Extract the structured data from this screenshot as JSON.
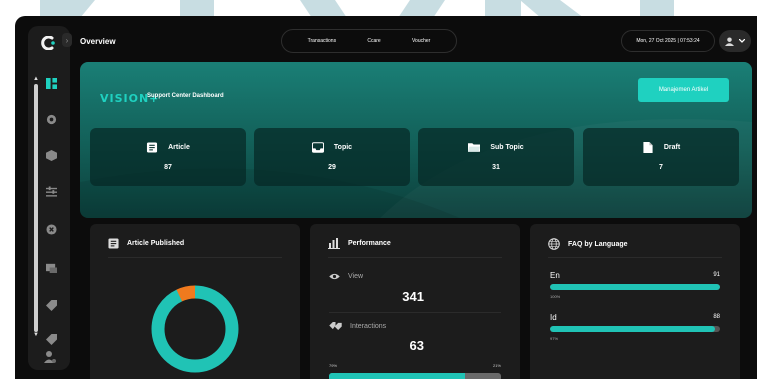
{
  "header": {
    "page_title": "Overview",
    "tabs": [
      "Transactions",
      "Ccare",
      "Voucher"
    ],
    "datetime": "Mon, 27 Oct 2025 | 07:53:24"
  },
  "hero": {
    "logo_text": "VISION+",
    "title": "Support Center Dashboard",
    "manage_button": "Manajemen Artikel",
    "stats": [
      {
        "label": "Article",
        "value": "87",
        "icon": "document-icon"
      },
      {
        "label": "Topic",
        "value": "29",
        "icon": "inbox-icon"
      },
      {
        "label": "Sub Topic",
        "value": "31",
        "icon": "folder-icon"
      },
      {
        "label": "Draft",
        "value": "7",
        "icon": "file-icon"
      }
    ]
  },
  "article_published": {
    "title": "Article Published",
    "donut_fraction_main": 0.93
  },
  "performance": {
    "title": "Performance",
    "view_label": "View",
    "view_value": "341",
    "interactions_label": "Interactions",
    "interactions_value": "63",
    "left_pct": "79%",
    "right_pct": "21%",
    "split_fraction": 0.79
  },
  "faq": {
    "title": "FAQ by Language",
    "languages": [
      {
        "code": "En",
        "count": "91",
        "pct": "100%",
        "fraction": 1.0
      },
      {
        "code": "Id",
        "count": "88",
        "pct": "97%",
        "fraction": 0.97
      }
    ]
  },
  "colors": {
    "accent": "#1fd1c0",
    "teal_bar": "#20c3b5",
    "orange": "#f07a1e",
    "background": "#0c0c0c",
    "card": "#1c1c1c"
  }
}
